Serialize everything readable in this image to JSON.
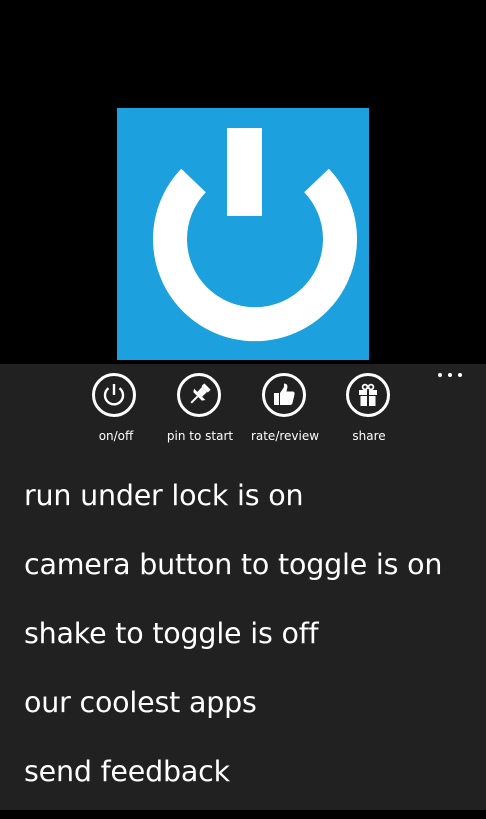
{
  "colors": {
    "accent": "#1ca1de",
    "background": "#000000",
    "app_bar_background": "#212121",
    "foreground": "#ffffff"
  },
  "tile": {
    "icon": "power-icon"
  },
  "app_bar": {
    "overflow_icon": "ellipsis-icon",
    "buttons": [
      {
        "label": "on/off",
        "icon": "power-icon"
      },
      {
        "label": "pin to start",
        "icon": "pin-icon"
      },
      {
        "label": "rate/review",
        "icon": "thumbs-up-icon"
      },
      {
        "label": "share",
        "icon": "gift-icon"
      }
    ]
  },
  "menu": {
    "items": [
      {
        "label": "run under lock is on"
      },
      {
        "label": "camera button to toggle is on"
      },
      {
        "label": "shake to toggle is off"
      },
      {
        "label": "our coolest apps"
      },
      {
        "label": "send feedback"
      }
    ]
  }
}
